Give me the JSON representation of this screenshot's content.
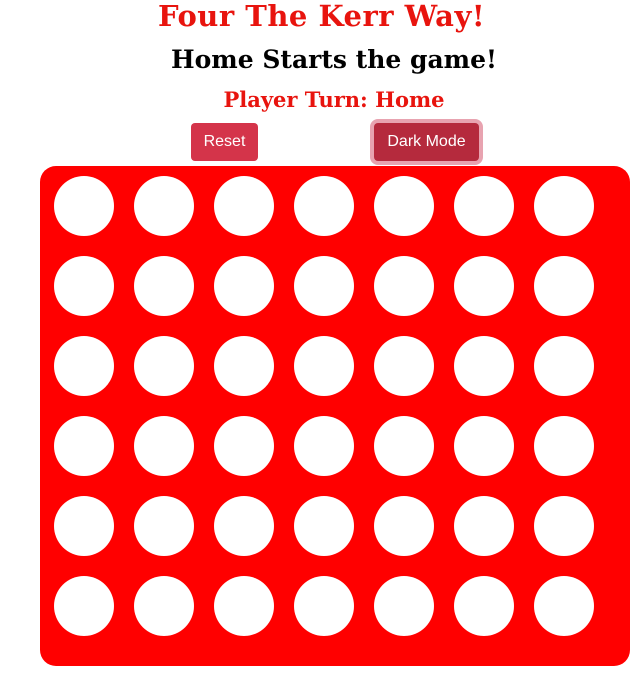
{
  "header": {
    "title": "Four The Kerr Way!",
    "subtitle": "Home Starts the game!",
    "turn_label": "Player Turn: Home"
  },
  "controls": {
    "reset_label": "Reset",
    "dark_mode_label": "Dark Mode"
  },
  "board": {
    "rows": 6,
    "columns": 7,
    "cells": [
      [
        "empty",
        "empty",
        "empty",
        "empty",
        "empty",
        "empty",
        "empty"
      ],
      [
        "empty",
        "empty",
        "empty",
        "empty",
        "empty",
        "empty",
        "empty"
      ],
      [
        "empty",
        "empty",
        "empty",
        "empty",
        "empty",
        "empty",
        "empty"
      ],
      [
        "empty",
        "empty",
        "empty",
        "empty",
        "empty",
        "empty",
        "empty"
      ],
      [
        "empty",
        "empty",
        "empty",
        "empty",
        "empty",
        "empty",
        "empty"
      ],
      [
        "empty",
        "empty",
        "empty",
        "empty",
        "empty",
        "empty",
        "empty"
      ]
    ]
  },
  "colors": {
    "accent": "#e8140e",
    "board": "#ff0000",
    "button": "#d4344a",
    "button_active": "#b52a3d",
    "empty_slot": "#ffffff"
  }
}
